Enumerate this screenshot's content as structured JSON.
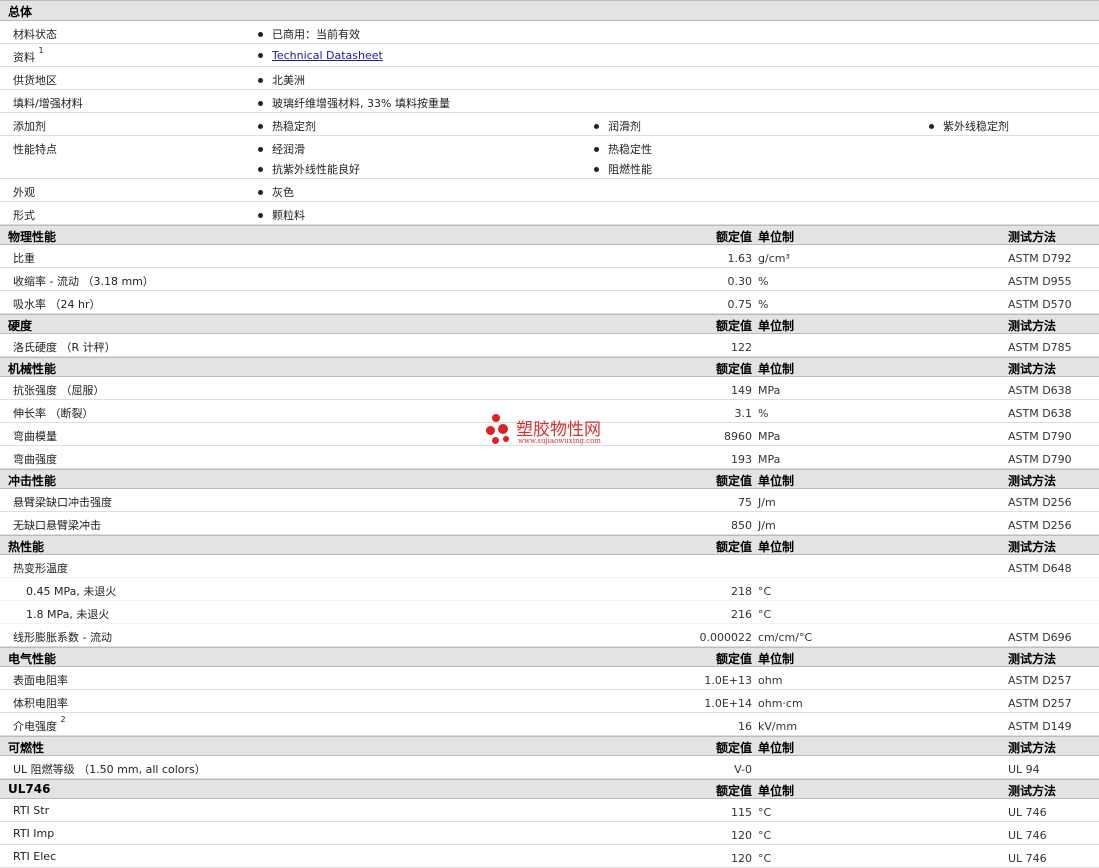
{
  "general": {
    "title": "总体",
    "rows": [
      {
        "label": "材料状态",
        "items": [
          "已商用：当前有效"
        ]
      },
      {
        "label": "资料",
        "sup": "1",
        "items": [
          "Technical Datasheet"
        ]
      },
      {
        "label": "供货地区",
        "items": [
          "北美洲"
        ]
      },
      {
        "label": "填料/增强材料",
        "items": [
          "玻璃纤维增强材料, 33% 填料按重量"
        ]
      },
      {
        "label": "添加剂",
        "items": [
          "热稳定剂",
          "润滑剂",
          "紫外线稳定剂"
        ]
      },
      {
        "label": "性能特点",
        "items": [
          "经润滑",
          "热稳定性",
          "抗紫外线性能良好",
          "阻燃性能"
        ]
      },
      {
        "label": "外观",
        "items": [
          "灰色"
        ]
      },
      {
        "label": "形式",
        "items": [
          "颗粒料"
        ]
      }
    ]
  },
  "headers": {
    "value": "额定值",
    "unit": "单位制",
    "method": "测试方法"
  },
  "sections": [
    {
      "title": "物理性能",
      "rows": [
        {
          "label": "比重",
          "value": "1.63",
          "unit": "g/cm³",
          "method": "ASTM D792"
        },
        {
          "label": "收缩率  - 流动 （3.18 mm）",
          "value": "0.30",
          "unit": "%",
          "method": "ASTM D955"
        },
        {
          "label": "吸水率 （24 hr）",
          "value": "0.75",
          "unit": "%",
          "method": "ASTM D570"
        }
      ]
    },
    {
      "title": "硬度",
      "rows": [
        {
          "label": "洛氏硬度 （R 计秤）",
          "value": "122",
          "unit": "",
          "method": "ASTM D785"
        }
      ]
    },
    {
      "title": "机械性能",
      "rows": [
        {
          "label": "抗张强度 （屈服）",
          "value": "149",
          "unit": "MPa",
          "method": "ASTM D638"
        },
        {
          "label": "伸长率 （断裂）",
          "value": "3.1",
          "unit": "%",
          "method": "ASTM D638"
        },
        {
          "label": "弯曲模量",
          "value": "8960",
          "unit": "MPa",
          "method": "ASTM D790"
        },
        {
          "label": "弯曲强度",
          "value": "193",
          "unit": "MPa",
          "method": "ASTM D790"
        }
      ]
    },
    {
      "title": "冲击性能",
      "rows": [
        {
          "label": "悬臂梁缺口冲击强度",
          "value": "75",
          "unit": "J/m",
          "method": "ASTM D256"
        },
        {
          "label": "无缺口悬臂梁冲击",
          "value": "850",
          "unit": "J/m",
          "method": "ASTM D256"
        }
      ]
    },
    {
      "title": "热性能",
      "rows": [
        {
          "label": "热变形温度",
          "value": "",
          "unit": "",
          "method": "ASTM D648"
        },
        {
          "label": "0.45 MPa, 未退火",
          "value": "218",
          "unit": "°C",
          "method": ""
        },
        {
          "label": "1.8 MPa, 未退火",
          "value": "216",
          "unit": "°C",
          "method": ""
        },
        {
          "label": "线形膨胀系数  - 流动",
          "value": "0.000022",
          "unit": "cm/cm/°C",
          "method": "ASTM D696"
        }
      ]
    },
    {
      "title": "电气性能",
      "rows": [
        {
          "label": "表面电阻率",
          "value": "1.0E+13",
          "unit": "ohm",
          "method": "ASTM D257"
        },
        {
          "label": "体积电阻率",
          "value": "1.0E+14",
          "unit": "ohm·cm",
          "method": "ASTM D257"
        },
        {
          "label": "介电强度",
          "sup": "2",
          "value": "16",
          "unit": "kV/mm",
          "method": "ASTM D149"
        }
      ]
    },
    {
      "title": "可燃性",
      "rows": [
        {
          "label": "UL 阻燃等级 （1.50 mm, all colors）",
          "value": "V-0",
          "unit": "",
          "method": "UL 94"
        }
      ]
    },
    {
      "title": "UL746",
      "rows": [
        {
          "label": "RTI Str",
          "value": "115",
          "unit": "°C",
          "method": "UL 746"
        },
        {
          "label": "RTI Imp",
          "value": "120",
          "unit": "°C",
          "method": "UL 746"
        },
        {
          "label": "RTI Elec",
          "value": "120",
          "unit": "°C",
          "method": "UL 746"
        }
      ]
    }
  ],
  "watermark": {
    "name": "塑胶物性网",
    "url": "www.sujiaowuxing.com",
    "color": "#e02020"
  }
}
